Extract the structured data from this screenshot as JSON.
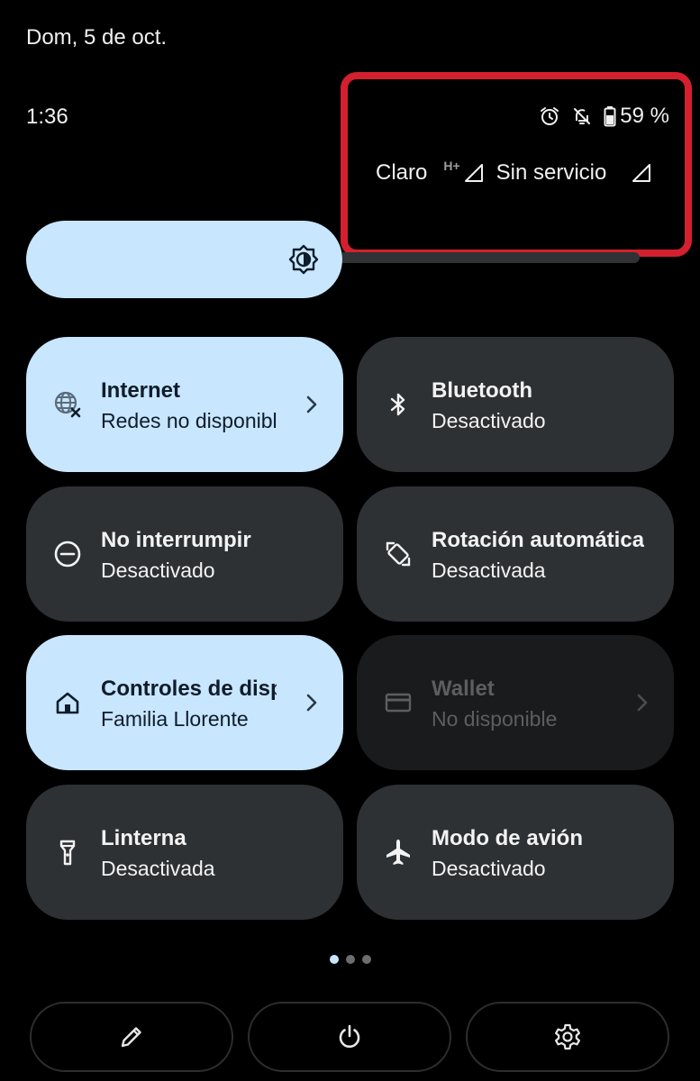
{
  "header": {
    "date": "Dom, 5 de oct.",
    "time": "1:36",
    "battery_percent": "59 %"
  },
  "network": {
    "carrier_1": "Claro",
    "carrier_1_tech": "H+",
    "carrier_2": "Sin servicio"
  },
  "brightness": {
    "level": 0.45
  },
  "tiles": {
    "internet": {
      "title": "Internet",
      "subtitle": "Redes no disponibles"
    },
    "bluetooth": {
      "title": "Bluetooth",
      "subtitle": "Desactivado"
    },
    "dnd": {
      "title": "No interrumpir",
      "subtitle": "Desactivado"
    },
    "rotation": {
      "title": "Rotación automática",
      "subtitle": "Desactivada"
    },
    "device_controls": {
      "title": "Controles de dispositivos",
      "subtitle": "Familia Llorente"
    },
    "wallet": {
      "title": "Wallet",
      "subtitle": "No disponible"
    },
    "flashlight": {
      "title": "Linterna",
      "subtitle": "Desactivada"
    },
    "airplane": {
      "title": "Modo de avión",
      "subtitle": "Desactivado"
    }
  },
  "pagination": {
    "current": 1,
    "total": 3
  },
  "colors": {
    "active_tile": "#c8e6fd",
    "inactive_tile": "#2e3134",
    "highlight_border": "#d3202f"
  },
  "icons": {
    "alarm": "alarm-icon",
    "bell_off": "bell-off-icon",
    "battery": "battery-icon",
    "signal": "signal-icon",
    "brightness": "brightness-icon",
    "globe_x": "globe-off-icon",
    "bluetooth": "bluetooth-icon",
    "dnd": "do-not-disturb-icon",
    "rotate": "rotate-icon",
    "home": "home-icon",
    "card": "card-icon",
    "flashlight": "flashlight-icon",
    "airplane": "airplane-icon",
    "pencil": "pencil-icon",
    "power": "power-icon",
    "gear": "gear-icon"
  }
}
